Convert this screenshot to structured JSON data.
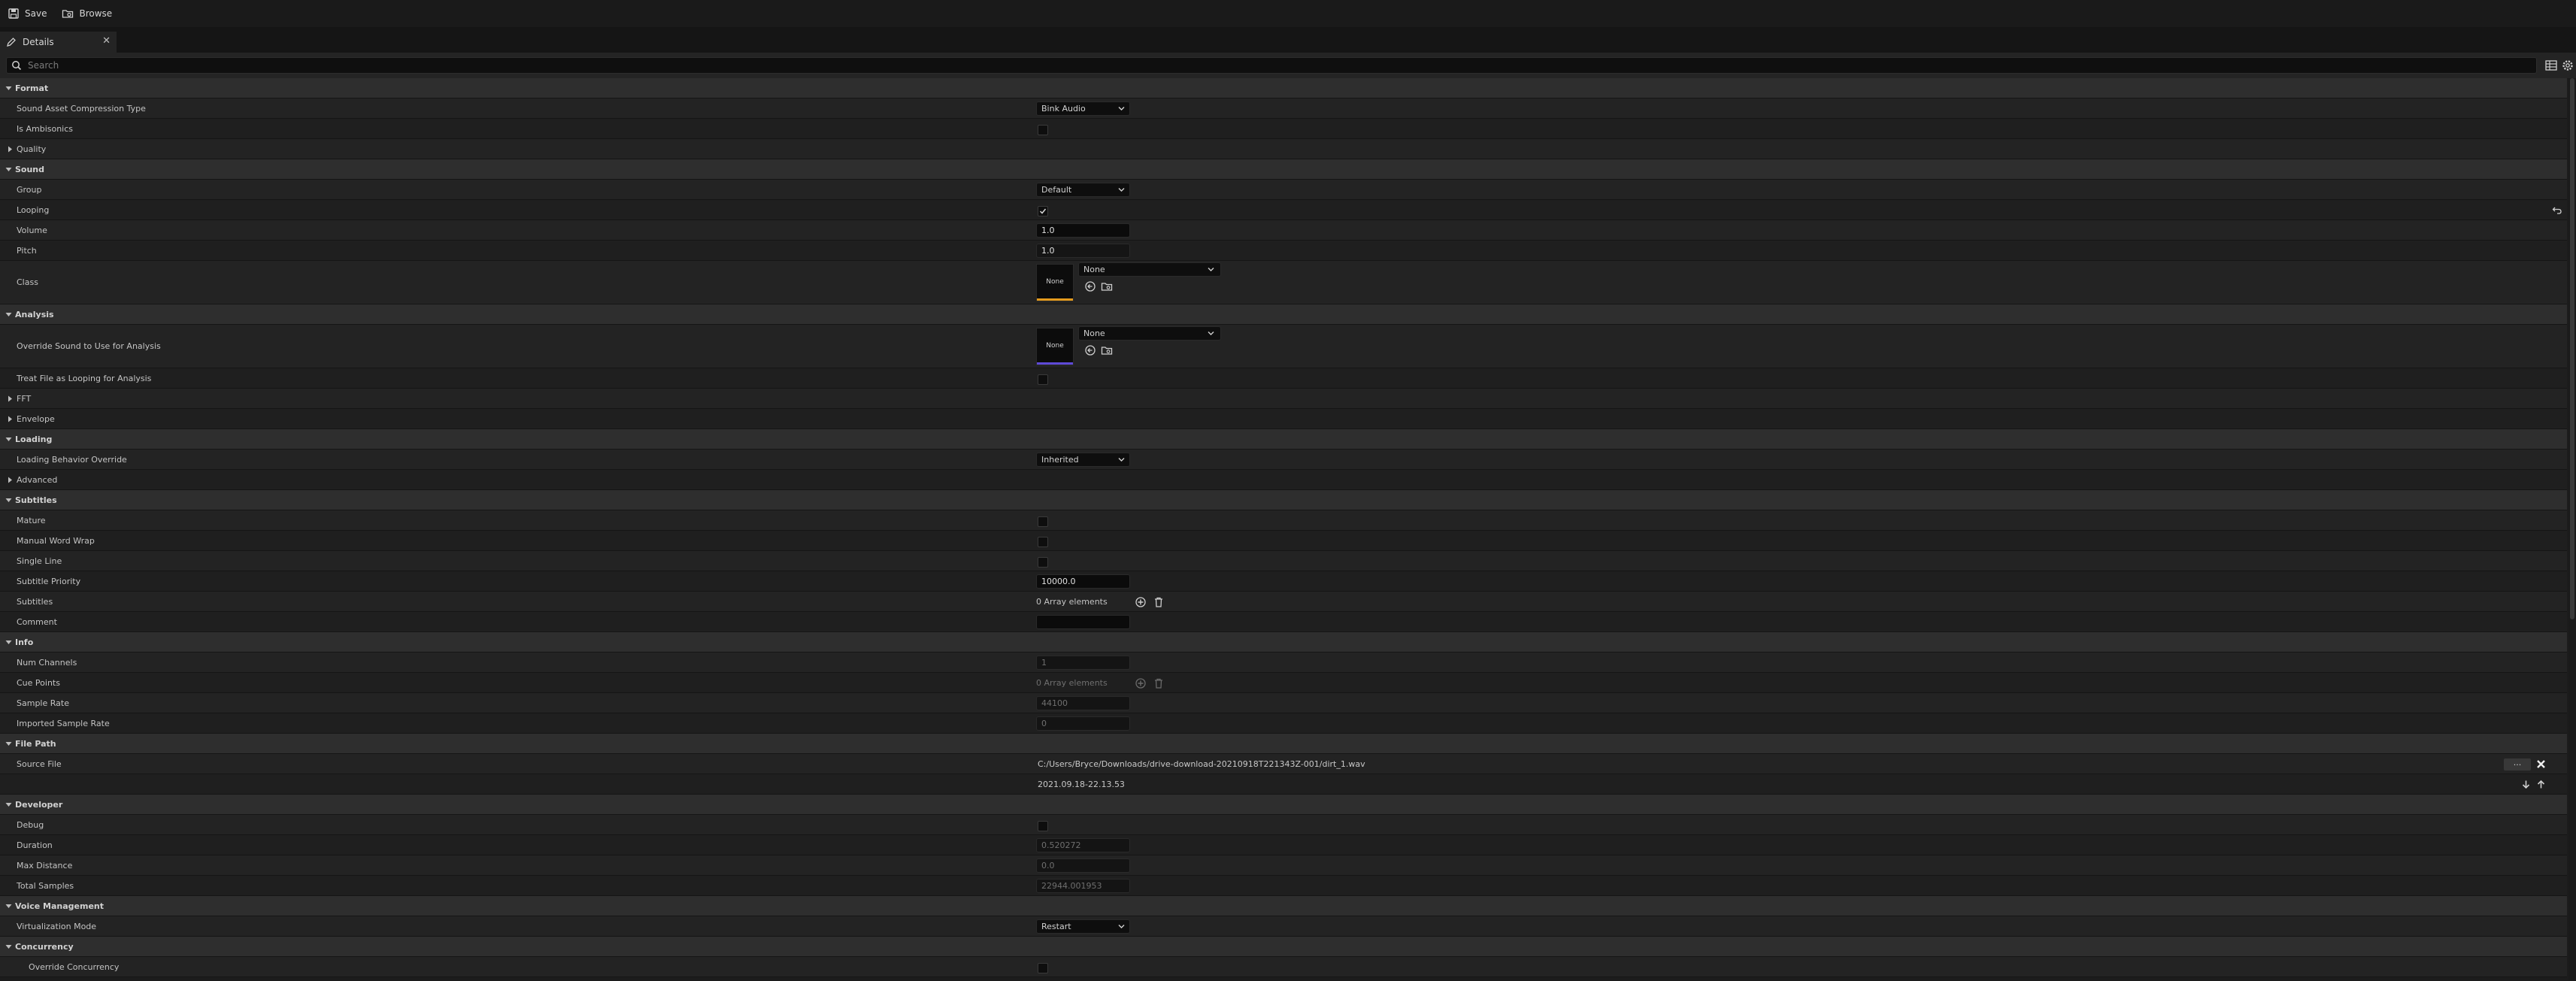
{
  "toolbar": {
    "save_label": "Save",
    "browse_label": "Browse"
  },
  "tab": {
    "label": "Details"
  },
  "search": {
    "placeholder": "Search"
  },
  "format": {
    "title": "Format",
    "compression_label": "Sound Asset Compression Type",
    "compression_value": "Bink Audio",
    "ambisonics_label": "Is Ambisonics",
    "ambisonics_checked": false,
    "quality_label": "Quality"
  },
  "sound": {
    "title": "Sound",
    "group_label": "Group",
    "group_value": "Default",
    "looping_label": "Looping",
    "looping_checked": true,
    "volume_label": "Volume",
    "volume_value": "1.0",
    "pitch_label": "Pitch",
    "pitch_value": "1.0",
    "class_label": "Class",
    "class_thumb": "None",
    "class_value": "None"
  },
  "analysis": {
    "title": "Analysis",
    "override_label": "Override Sound to Use for Analysis",
    "override_thumb": "None",
    "override_value": "None",
    "treat_label": "Treat File as Looping for Analysis",
    "fft_label": "FFT",
    "envelope_label": "Envelope"
  },
  "loading": {
    "title": "Loading",
    "behavior_label": "Loading Behavior Override",
    "behavior_value": "Inherited",
    "advanced_label": "Advanced"
  },
  "subtitles": {
    "title": "Subtitles",
    "mature_label": "Mature",
    "wrap_label": "Manual Word Wrap",
    "single_label": "Single Line",
    "priority_label": "Subtitle Priority",
    "priority_value": "10000.0",
    "subtitles_label": "Subtitles",
    "subtitles_value": "0 Array elements",
    "comment_label": "Comment",
    "comment_value": ""
  },
  "info": {
    "title": "Info",
    "channels_label": "Num Channels",
    "channels_value": "1",
    "cue_label": "Cue Points",
    "cue_value": "0 Array elements",
    "rate_label": "Sample Rate",
    "rate_value": "44100",
    "imported_label": "Imported Sample Rate",
    "imported_value": "0"
  },
  "filepath": {
    "title": "File Path",
    "source_label": "Source File",
    "source_value": "C:/Users/Bryce/Downloads/drive-download-20210918T221343Z-001/dirt_1.wav",
    "browse_btn": "...",
    "timestamp": "2021.09.18-22.13.53"
  },
  "developer": {
    "title": "Developer",
    "debug_label": "Debug",
    "duration_label": "Duration",
    "duration_value": "0.520272",
    "maxdist_label": "Max Distance",
    "maxdist_value": "0.0",
    "samples_label": "Total Samples",
    "samples_value": "22944.001953"
  },
  "voice": {
    "title": "Voice Management",
    "virt_label": "Virtualization Mode",
    "virt_value": "Restart"
  },
  "concurrency": {
    "title": "Concurrency",
    "override_label": "Override Concurrency"
  },
  "colors": {
    "class_accent": "#e39a1e",
    "analysis_accent": "#5e4ad6"
  }
}
